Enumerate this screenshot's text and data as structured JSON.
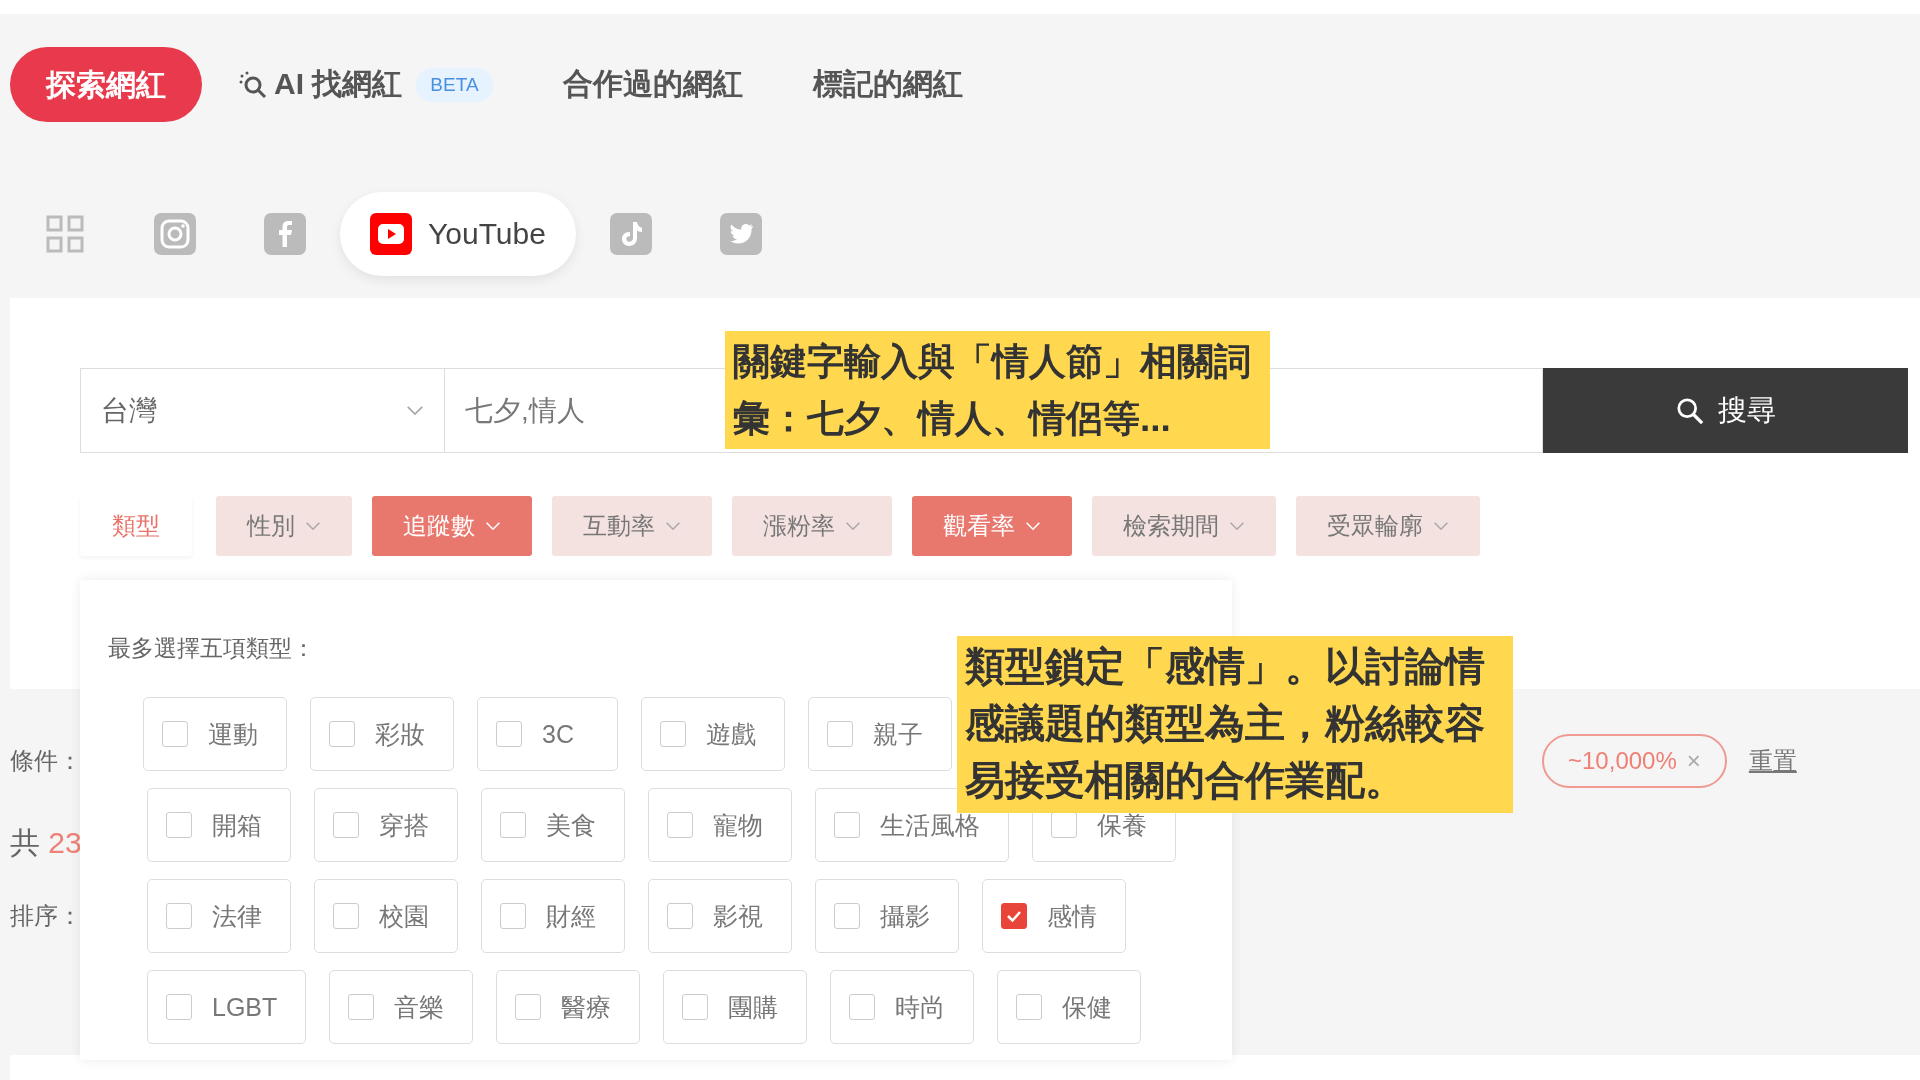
{
  "nav_tabs": [
    {
      "label": "探索網紅",
      "selected": true,
      "kind": "plain"
    },
    {
      "label": "AI 找網紅",
      "selected": false,
      "kind": "ai",
      "badge": "BETA"
    },
    {
      "label": "合作過的網紅",
      "selected": false,
      "kind": "plain"
    },
    {
      "label": "標記的網紅",
      "selected": false,
      "kind": "plain"
    }
  ],
  "platforms": [
    {
      "kind": "all",
      "selected": false
    },
    {
      "kind": "instagram",
      "selected": false
    },
    {
      "kind": "facebook",
      "selected": false
    },
    {
      "kind": "youtube",
      "label": "YouTube",
      "selected": true
    },
    {
      "kind": "tiktok",
      "selected": false
    },
    {
      "kind": "twitter",
      "selected": false
    }
  ],
  "search": {
    "region": "台灣",
    "keyword": "七夕,情人",
    "button": "搜尋"
  },
  "filters": [
    {
      "label": "類型",
      "kind": "plain",
      "selected": false
    },
    {
      "label": "性別",
      "kind": "dropdown",
      "selected": false
    },
    {
      "label": "追蹤數",
      "kind": "dropdown",
      "selected": true
    },
    {
      "label": "互動率",
      "kind": "dropdown",
      "selected": false
    },
    {
      "label": "漲粉率",
      "kind": "dropdown",
      "selected": false
    },
    {
      "label": "觀看率",
      "kind": "dropdown",
      "selected": true
    },
    {
      "label": "檢索期間",
      "kind": "dropdown",
      "selected": false
    },
    {
      "label": "受眾輪廓",
      "kind": "dropdown",
      "selected": false
    }
  ],
  "conditions": {
    "label": "條件：",
    "tag": "~10,000%",
    "tag_close": "×",
    "reset": "重置"
  },
  "total": {
    "prefix": "共",
    "count": "23"
  },
  "sort": {
    "label": "排序："
  },
  "category_panel": {
    "title": "最多選擇五項類型：",
    "rows": [
      [
        {
          "label": "運動",
          "checked": false
        },
        {
          "label": "彩妝",
          "checked": false
        },
        {
          "label": "3C",
          "checked": false
        },
        {
          "label": "遊戲",
          "checked": false
        },
        {
          "label": "親子",
          "checked": false
        }
      ],
      [
        {
          "label": "開箱",
          "checked": false
        },
        {
          "label": "穿搭",
          "checked": false
        },
        {
          "label": "美食",
          "checked": false
        },
        {
          "label": "寵物",
          "checked": false
        },
        {
          "label": "生活風格",
          "checked": false
        },
        {
          "label": "保養",
          "checked": false
        }
      ],
      [
        {
          "label": "法律",
          "checked": false
        },
        {
          "label": "校園",
          "checked": false
        },
        {
          "label": "財經",
          "checked": false
        },
        {
          "label": "影視",
          "checked": false
        },
        {
          "label": "攝影",
          "checked": false
        },
        {
          "label": "感情",
          "checked": true
        }
      ],
      [
        {
          "label": "LGBT",
          "checked": false
        },
        {
          "label": "音樂",
          "checked": false
        },
        {
          "label": "醫療",
          "checked": false
        },
        {
          "label": "團購",
          "checked": false
        },
        {
          "label": "時尚",
          "checked": false
        },
        {
          "label": "保健",
          "checked": false
        }
      ]
    ]
  },
  "annotations": [
    {
      "text": "關鍵字輸入與「情人節」相關詞彙：七夕、情人、情侶等..."
    },
    {
      "text": "類型鎖定「感情」。以討論情感議題的類型為主，粉絲較容易接受相關的合作業配。"
    }
  ]
}
